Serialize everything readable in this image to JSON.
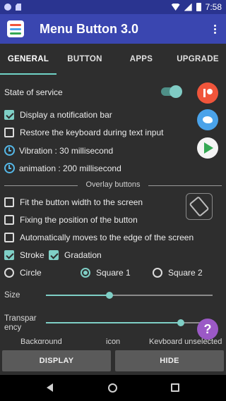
{
  "status_bar": {
    "time": "7:58"
  },
  "app_bar": {
    "title": "Menu Button 3.0"
  },
  "tabs": [
    {
      "label": "GENERAL",
      "active": true
    },
    {
      "label": "BUTTON",
      "active": false
    },
    {
      "label": "APPS",
      "active": false
    },
    {
      "label": "UPGRADE",
      "active": false
    }
  ],
  "general": {
    "state_of_service": {
      "label": "State of service",
      "enabled": true
    },
    "display_notification_bar": {
      "label": "Display a notification bar",
      "checked": true
    },
    "restore_keyboard": {
      "label": "Restore the keyboard during text input",
      "checked": false
    },
    "vibration": {
      "label": "Vibration : 30 millisecond"
    },
    "animation": {
      "label": "animation : 200 millisecond"
    }
  },
  "overlay": {
    "section_label": "Overlay buttons",
    "fit_width": {
      "label": "Fit the button width to the screen",
      "checked": false
    },
    "fix_position": {
      "label": "Fixing the position of the button",
      "checked": false
    },
    "auto_edge": {
      "label": "Automatically moves to the edge of the screen",
      "checked": false
    },
    "stroke": {
      "label": "Stroke",
      "checked": true
    },
    "gradation": {
      "label": "Gradation",
      "checked": true
    },
    "shape_options": [
      {
        "label": "Circle",
        "selected": false
      },
      {
        "label": "Square 1",
        "selected": true
      },
      {
        "label": "Square 2",
        "selected": false
      }
    ],
    "size": {
      "label": "Size",
      "value": 0.38
    },
    "transparency": {
      "label_line1": "Transpar",
      "label_line2": "ency",
      "value": 0.81
    },
    "color_labels": [
      "Background",
      "icon",
      "Keyboard unselected"
    ]
  },
  "actions": {
    "display": "DISPLAY",
    "hide": "HIDE"
  },
  "side_icons": [
    "patreon-icon",
    "twitter-icon",
    "google-play-icon",
    "rotate-screen-icon",
    "help-icon"
  ],
  "colors": {
    "accent": "#7fcfc6",
    "app_bar": "#3a46b0",
    "status_bar": "#2a3490",
    "background": "#2e2e2e"
  }
}
